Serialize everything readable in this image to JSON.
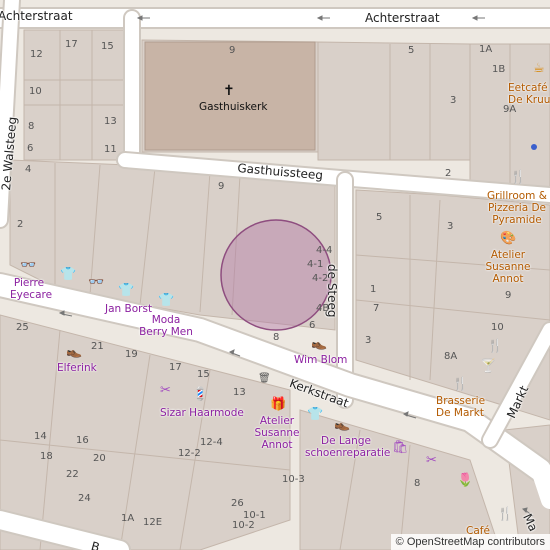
{
  "map": {
    "streets": {
      "achterstraat_left": "Achterstraat",
      "achterstraat_right": "Achterstraat",
      "gasthuissteeg": "Gasthuissteeg",
      "de_steeg": "de Steeg",
      "walsteeg": "2e Walsteeg",
      "kerkstraat": "Kerkstraat",
      "markt": "Markt",
      "ma_partial": "Ma",
      "bottom_partial": "B"
    },
    "landmark": {
      "name": "Gasthuiskerk",
      "icon": "church-cross-icon",
      "number": "9"
    },
    "house_numbers": [
      "12",
      "17",
      "15",
      "10",
      "8",
      "6",
      "4",
      "13",
      "11",
      "2",
      "9",
      "5",
      "1A",
      "1B",
      "9A",
      "3",
      "2",
      "9",
      "5",
      "3",
      "1",
      "7",
      "4-4",
      "4-1",
      "4-2",
      "4B",
      "6",
      "8",
      "3",
      "10",
      "8A",
      "25",
      "21",
      "19",
      "17",
      "15",
      "13",
      "12-4",
      "12-2",
      "14",
      "16",
      "18",
      "20",
      "22",
      "24",
      "26",
      "10-1",
      "10-2",
      "10-3",
      "8",
      "1A",
      "12E",
      "8A"
    ],
    "pois": [
      {
        "name": "Pierre Eyecare",
        "icon": "glasses-icon",
        "color": "#8b1fa0"
      },
      {
        "name": "Jan Borst",
        "icon": "clothes-icon",
        "color": "#8b1fa0"
      },
      {
        "name": "Moda Berry Men",
        "icon": "clothes-icon",
        "color": "#8b1fa0"
      },
      {
        "name": "Wim Blom",
        "icon": "shoe-icon",
        "color": "#8b1fa0"
      },
      {
        "name": "Elferink",
        "icon": "shoe-icon",
        "color": "#8b1fa0"
      },
      {
        "name": "Sizar Haarmode",
        "icon": "hairdresser-icon",
        "color": "#8b1fa0"
      },
      {
        "name": "Atelier Susanne Annot",
        "icon": "gift-icon",
        "color": "#8b1fa0"
      },
      {
        "name": "De Lange schoenreparatie",
        "icon": "shoe-icon",
        "color": "#8b1fa0"
      },
      {
        "name": "Eetcafé De Kruu",
        "icon": "cafe-icon",
        "color": "#b35a00"
      },
      {
        "name": "Grillroom & Pizzeria De Pyramide",
        "icon": "restaurant-icon",
        "color": "#b35a00"
      },
      {
        "name": "Atelier Susanne Annot",
        "icon": "art-palette-icon",
        "color": "#b35a00"
      },
      {
        "name": "Brasserie De Markt",
        "icon": "restaurant-icon",
        "color": "#b35a00"
      },
      {
        "name": "Café",
        "icon": "restaurant-icon",
        "color": "#b35a00"
      }
    ],
    "attribution": "© OpenStreetMap contributors",
    "colors": {
      "building": "#d9d0c9",
      "building_outline": "#c4b6ab",
      "church": "#c8b4a6",
      "road": "#ffffff",
      "road_casing": "#cfc8c0",
      "background": "#f2efe9",
      "highlight_circle": "#b47aa6",
      "poi_shop": "#8b1fa0",
      "poi_food": "#b35a00"
    }
  }
}
